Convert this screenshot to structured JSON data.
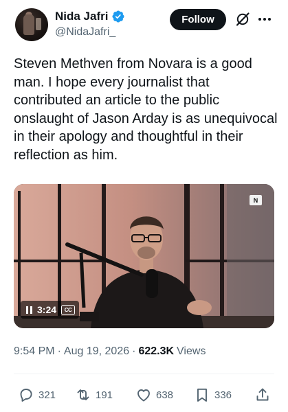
{
  "author": {
    "display_name": "Nida Jafri",
    "handle": "@NidaJafri_",
    "verified": true
  },
  "header": {
    "follow_label": "Follow",
    "icons": [
      "grok-icon",
      "more-icon"
    ]
  },
  "tweet": {
    "text": "Steven Methven from Novara is a good man. I hope every journalist that contributed an article to the public onslaught of Jason Arday is as unequivocal in their apology and thoughtful in their reflection as him."
  },
  "video": {
    "duration": "3:24",
    "state": "playing",
    "captions_label": "CC",
    "logo_text": "N"
  },
  "meta": {
    "time": "9:54 PM",
    "separator": "·",
    "date": "Aug 19, 2026",
    "views_count": "622.3K",
    "views_label": "Views"
  },
  "actions": {
    "replies": "321",
    "reposts": "191",
    "likes": "638",
    "bookmarks": "336"
  },
  "colors": {
    "verified_blue": "#1d9bf0",
    "text_primary": "#0f1419",
    "text_secondary": "#536471",
    "follow_bg": "#0f1419"
  }
}
